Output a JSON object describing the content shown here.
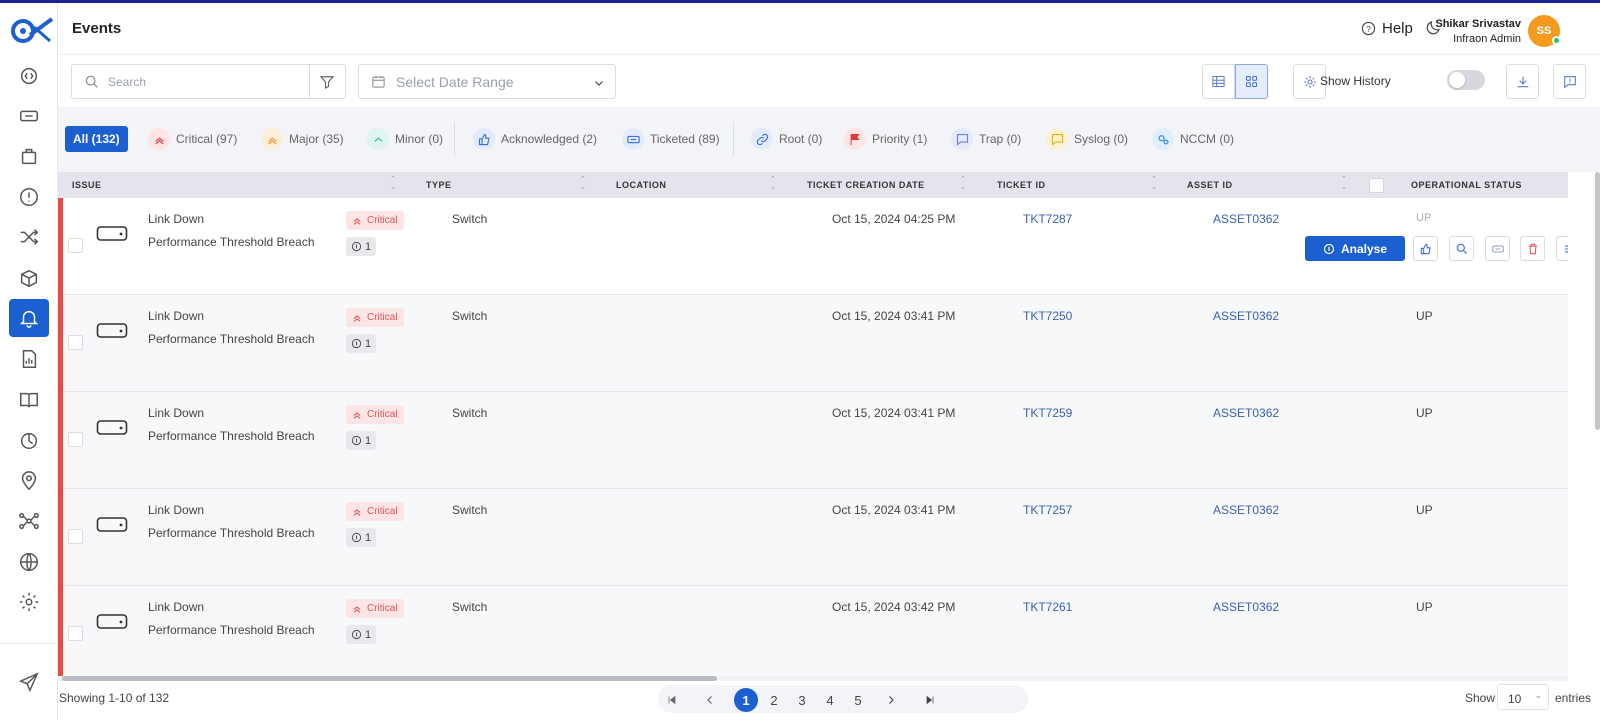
{
  "page": {
    "title": "Events"
  },
  "header": {
    "help_label": "Help",
    "user_name": "Shikar Srivastav",
    "user_role": "Infraon Admin",
    "avatar_initials": "SS"
  },
  "toolbar": {
    "search_placeholder": "Search",
    "date_placeholder": "Select Date Range",
    "show_history_label": "Show History",
    "show_history_on": false
  },
  "sidebar": {
    "items": [
      "code-gear-icon",
      "ticket-icon",
      "bag-icon",
      "alert-icon",
      "shuffle-icon",
      "box-icon",
      "bell-icon",
      "report-icon",
      "book-icon",
      "timer-icon",
      "location-icon",
      "network-icon",
      "globe-icon",
      "settings-icon",
      "send-icon"
    ],
    "active": "bell-icon"
  },
  "filters": [
    {
      "label": "All (132)",
      "icon": "none"
    },
    {
      "label": "Critical (97)",
      "icon": "critical-icon",
      "color": "#e84a4a"
    },
    {
      "label": "Major (35)",
      "icon": "major-icon",
      "color": "#f2a03d"
    },
    {
      "label": "Minor (0)",
      "icon": "minor-icon",
      "color": "#3fbfae"
    },
    {
      "label": "Acknowledged (2)",
      "icon": "thumbs-up-icon",
      "color": "#3b6fd8"
    },
    {
      "label": "Ticketed (89)",
      "icon": "ticket-icon",
      "color": "#3b6fd8"
    },
    {
      "label": "Root (0)",
      "icon": "link-icon",
      "color": "#3b6fd8"
    },
    {
      "label": "Priority (1)",
      "icon": "flag-icon",
      "color": "#e03a3a"
    },
    {
      "label": "Trap (0)",
      "icon": "chat-icon",
      "color": "#6b7fe0"
    },
    {
      "label": "Syslog (0)",
      "icon": "syslog-icon",
      "color": "#e0b020"
    },
    {
      "label": "NCCM (0)",
      "icon": "gears-icon",
      "color": "#3b8fe0"
    }
  ],
  "table": {
    "columns": [
      "ISSUE",
      "TYPE",
      "LOCATION",
      "TICKET CREATION DATE",
      "TICKET ID",
      "ASSET ID",
      "OPERATIONAL STATUS"
    ],
    "rows": [
      {
        "title": "Link Down",
        "subtitle": "Performance Threshold Breach",
        "severity": "Critical",
        "count": "1",
        "type": "Switch",
        "location": "",
        "date": "Oct 15, 2024 04:25 PM",
        "ticket": "TKT7287",
        "asset": "ASSET0362",
        "status": "UP"
      },
      {
        "title": "Link Down",
        "subtitle": "Performance Threshold Breach",
        "severity": "Critical",
        "count": "1",
        "type": "Switch",
        "location": "",
        "date": "Oct 15, 2024 03:41 PM",
        "ticket": "TKT7250",
        "asset": "ASSET0362",
        "status": "UP"
      },
      {
        "title": "Link Down",
        "subtitle": "Performance Threshold Breach",
        "severity": "Critical",
        "count": "1",
        "type": "Switch",
        "location": "",
        "date": "Oct 15, 2024 03:41 PM",
        "ticket": "TKT7259",
        "asset": "ASSET0362",
        "status": "UP"
      },
      {
        "title": "Link Down",
        "subtitle": "Performance Threshold Breach",
        "severity": "Critical",
        "count": "1",
        "type": "Switch",
        "location": "",
        "date": "Oct 15, 2024 03:41 PM",
        "ticket": "TKT7257",
        "asset": "ASSET0362",
        "status": "UP"
      },
      {
        "title": "Link Down",
        "subtitle": "Performance Threshold Breach",
        "severity": "Critical",
        "count": "1",
        "type": "Switch",
        "location": "",
        "date": "Oct 15, 2024 03:42 PM",
        "ticket": "TKT7261",
        "asset": "ASSET0362",
        "status": "UP"
      }
    ],
    "row_actions": {
      "analyse_label": "Analyse",
      "icons": [
        "thumbs-up-icon",
        "search-icon",
        "ticket-icon",
        "delete-icon",
        "menu-icon"
      ]
    }
  },
  "footer": {
    "showing": "Showing 1-10 of 132",
    "pages": [
      "1",
      "2",
      "3",
      "4",
      "5"
    ],
    "current_page": "1",
    "show_label": "Show",
    "page_size": "10",
    "entries_label": "entries"
  },
  "colors": {
    "primary": "#1c5fd0",
    "critical": "#e84a4a",
    "header_bg": "#e4e5ec"
  }
}
